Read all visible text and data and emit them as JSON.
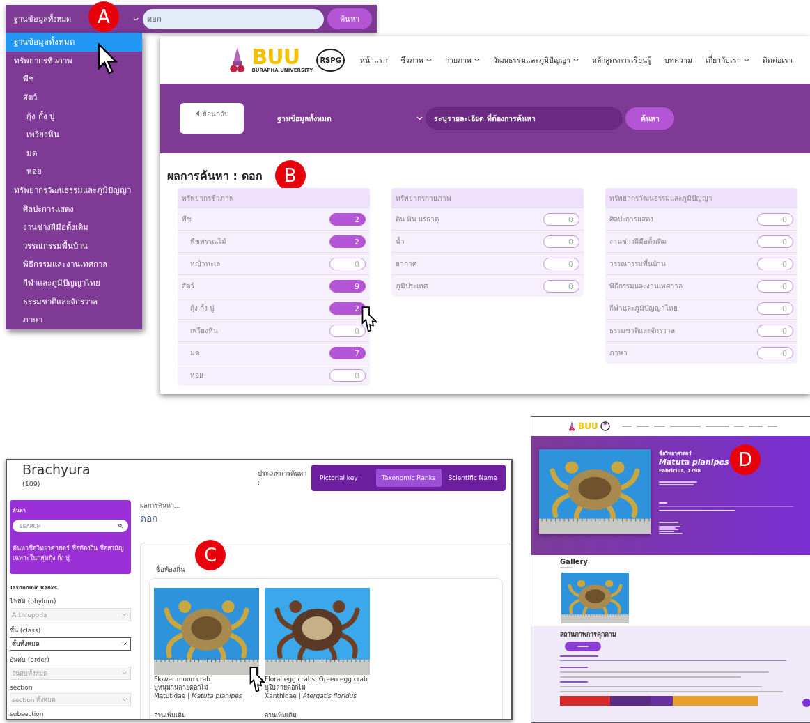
{
  "panel_a": {
    "marker": "A",
    "select": {
      "value": "ฐานข้อมูลทั้งหมด"
    },
    "search": {
      "value": "ดอก"
    },
    "search_button": "ค้นหา",
    "options": [
      {
        "label": "ฐานข้อมูลทั้งหมด",
        "selected": true
      },
      {
        "label": "ทรัพยากรชีวภาพ",
        "selected": false,
        "children": [
          {
            "label": "พืช",
            "selected": false
          },
          {
            "label": "สัตว์",
            "selected": false,
            "children": [
              {
                "label": "กุ้ง กั้ง ปู",
                "selected": false
              },
              {
                "label": "เพรียงหิน",
                "selected": false
              },
              {
                "label": "มด",
                "selected": false
              },
              {
                "label": "หอย",
                "selected": false
              }
            ]
          }
        ]
      },
      {
        "label": "ทรัพยากรวัฒนธรรมและภูมิปัญญา",
        "selected": false,
        "children": [
          {
            "label": "ศิลปะการแสดง",
            "selected": false
          },
          {
            "label": "งานช่างฝีมือดั้งเดิม",
            "selected": false
          },
          {
            "label": "วรรณกรรมพื้นบ้าน",
            "selected": false
          },
          {
            "label": "พิธีกรรมและงานเทศกาล",
            "selected": false
          },
          {
            "label": "กีฬาและภูมิปัญญาไทย",
            "selected": false
          },
          {
            "label": "ธรรมชาติและจักรวาล",
            "selected": false
          },
          {
            "label": "ภาษา",
            "selected": false
          }
        ]
      }
    ]
  },
  "panel_b": {
    "logo": {
      "wordmark": "BUU",
      "subtitle": "BURAPHA UNIVERSITY",
      "partner": "RSPG"
    },
    "nav": [
      {
        "label": "หน้าแรก",
        "has_menu": false
      },
      {
        "label": "ชีวภาพ",
        "has_menu": true
      },
      {
        "label": "กายภาพ",
        "has_menu": true
      },
      {
        "label": "วัฒนธรรมและภูมิปัญญา",
        "has_menu": true
      },
      {
        "label": "หลักสูตรการเรียนรู้",
        "has_menu": false
      },
      {
        "label": "บทความ",
        "has_menu": false
      },
      {
        "label": "เกี่ยวกับเรา",
        "has_menu": true
      },
      {
        "label": "ติดต่อเรา",
        "has_menu": false
      }
    ],
    "back_button": "ย้อนกลับ",
    "database": "ฐานข้อมูลทั้งหมด",
    "search": {
      "placeholder": "ระบุรายละเอียด ที่ต้องการค้นหา"
    },
    "search_button": "ค้นหา",
    "heading": "ผลการค้นหา : ดอก",
    "marker": "B",
    "groups": [
      {
        "title": "ทรัพยากรชีวภาพ",
        "items": [
          {
            "label": "พืช",
            "count": "2",
            "highlighted": true,
            "children": [
              {
                "label": "พืชพรรณไม้",
                "count": "2",
                "highlighted": true
              },
              {
                "label": "หญ้าทะเล",
                "count": "0",
                "highlighted": false
              }
            ]
          },
          {
            "label": "สัตว์",
            "count": "9",
            "highlighted": true,
            "children": [
              {
                "label": "กุ้ง กั้ง ปู",
                "count": "2",
                "highlighted": true
              },
              {
                "label": "เพรียงหิน",
                "count": "0",
                "highlighted": false
              },
              {
                "label": "มด",
                "count": "7",
                "highlighted": true
              },
              {
                "label": "หอย",
                "count": "0",
                "highlighted": false
              }
            ]
          }
        ]
      },
      {
        "title": "ทรัพยากรกายภาพ",
        "items": [
          {
            "label": "ดิน หิน แร่ธาตุ",
            "count": "0",
            "highlighted": false
          },
          {
            "label": "น้ำ",
            "count": "0",
            "highlighted": false
          },
          {
            "label": "อากาศ",
            "count": "0",
            "highlighted": false
          },
          {
            "label": "ภูมิประเทศ",
            "count": "0",
            "highlighted": false
          }
        ]
      },
      {
        "title": "ทรัพยากรวัฒนธรรมและภูมิปัญญา",
        "items": [
          {
            "label": "ศิลปะการแสดง",
            "count": "0",
            "highlighted": false
          },
          {
            "label": "งานช่างฝีมือดั้งเดิม",
            "count": "0",
            "highlighted": false
          },
          {
            "label": "วรรณกรรมพื้นบ้าน",
            "count": "0",
            "highlighted": false
          },
          {
            "label": "พิธีกรรมและงานเทศกาล",
            "count": "0",
            "highlighted": false
          },
          {
            "label": "กีฬาและภูมิปัญญาไทย",
            "count": "0",
            "highlighted": false
          },
          {
            "label": "ธรรมชาติและจักรวาล",
            "count": "0",
            "highlighted": false
          },
          {
            "label": "ภาษา",
            "count": "0",
            "highlighted": false
          }
        ]
      }
    ]
  },
  "panel_c": {
    "title": "Brachyura",
    "count": "(109)",
    "search_type_label": "ประเภทการค้นหา :",
    "tabs": [
      {
        "label": "Pictorial key",
        "selected": false
      },
      {
        "label": "Taxonomic Ranks",
        "selected": true
      },
      {
        "label": "Scientific Name",
        "selected": false
      }
    ],
    "search_box": {
      "title": "ค้นหา",
      "placeholder": "SEARCH",
      "hint": "ค้นหาชื่อวิทยาศาสตร์ ชื่อท้องถิ่น ชื่อสามัญ เฉพาะในกลุ่มกุ้ง กั้ง ปู"
    },
    "ranks_heading": "Taxonomic Ranks",
    "filters": [
      {
        "label": "ไฟลัม (phylum)",
        "value": "Arthropoda",
        "disabled": true
      },
      {
        "label": "ชั้น (class)",
        "value": "ชั้นทั้งหมด",
        "disabled": false
      },
      {
        "label": "อันดับ (order)",
        "value": "อันดับทั้งหมด",
        "disabled": true
      },
      {
        "label": "section",
        "value": "section ทั้งหมด",
        "disabled": true
      },
      {
        "label": "subsection"
      }
    ],
    "results_label": "ผลการค้นหา...",
    "query": "ดอก",
    "marker": "C",
    "section_title": "ชื่อท้องถิ่น",
    "cards": [
      {
        "common_name": "Flower moon crab",
        "thai_name": "ปูหนุมานลายดอกไม้",
        "taxon": "Matutidae | *Matuta planipes*",
        "more": "อ่านเพิ่มเติม"
      },
      {
        "common_name": "Floral egg crabs, Green egg crab",
        "thai_name": "ปูใบ้ลายดอกไม้",
        "taxon": "Xanthidae | *Atergatis floridus*",
        "more": "อ่านเพิ่มเติม"
      }
    ]
  },
  "panel_d": {
    "logo": "BUU",
    "marker": "D",
    "label": "ชื่อวิทยาศาสตร์",
    "title": "Matuta planipes",
    "author": "Fabricius, 1798",
    "gallery_heading": "Gallery",
    "threat_heading": "สถานภาพการคุกคาม"
  }
}
